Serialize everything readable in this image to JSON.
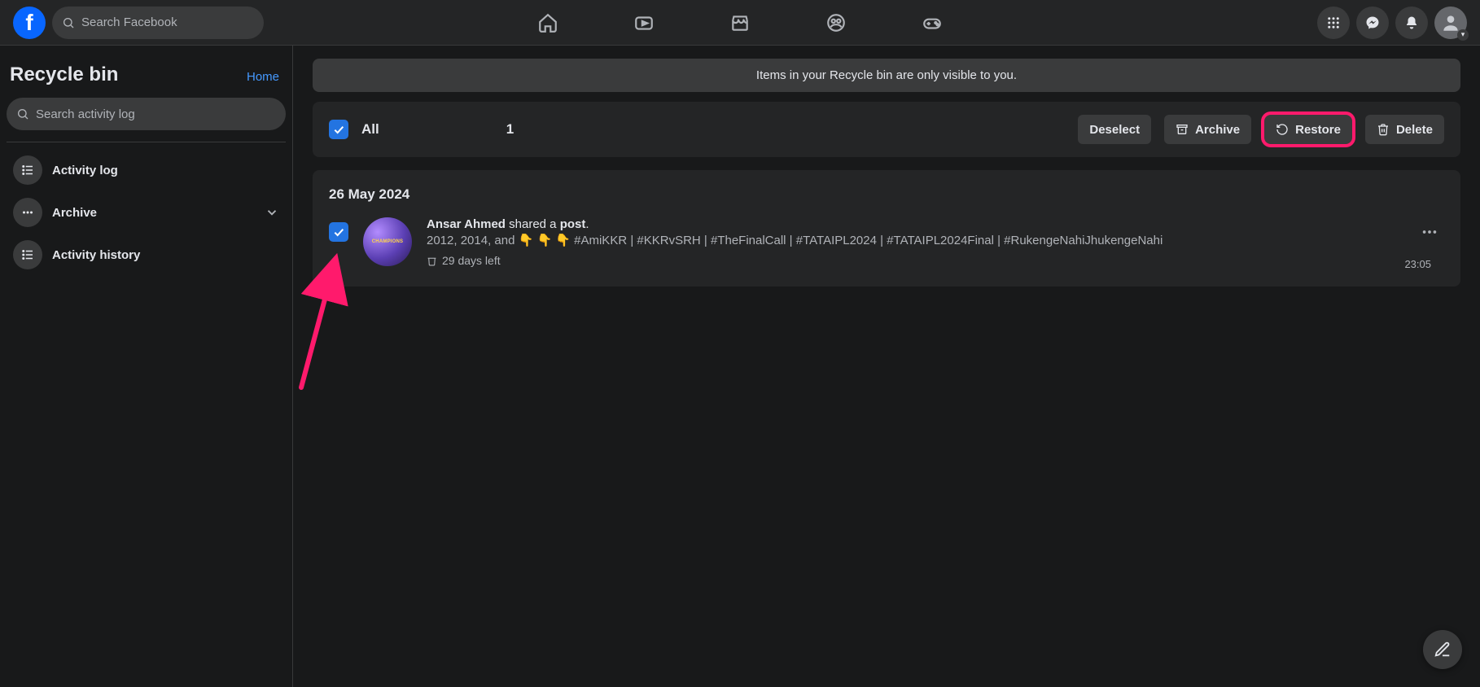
{
  "topbar": {
    "search_placeholder": "Search Facebook"
  },
  "sidebar": {
    "title": "Recycle bin",
    "home_link": "Home",
    "search_placeholder": "Search activity log",
    "items": [
      {
        "label": "Activity log"
      },
      {
        "label": "Archive"
      },
      {
        "label": "Activity history"
      }
    ]
  },
  "banner": "Items in your Recycle bin are only visible to you.",
  "actions": {
    "all_label": "All",
    "selected_count": "1",
    "deselect": "Deselect",
    "archive": "Archive",
    "restore": "Restore",
    "delete": "Delete"
  },
  "group": {
    "date": "26 May 2024",
    "entry": {
      "actor": "Ansar Ahmed",
      "verb": " shared a ",
      "object": "post",
      "tail": ".",
      "description": "2012, 2014, and 👇 👇 👇  #AmiKKR | #KKRvSRH | #TheFinalCall | #TATAIPL2024 | #TATAIPL2024Final | #RukengeNahiJhukengeNahi",
      "time_left": "29 days left",
      "timestamp": "23:05"
    }
  }
}
